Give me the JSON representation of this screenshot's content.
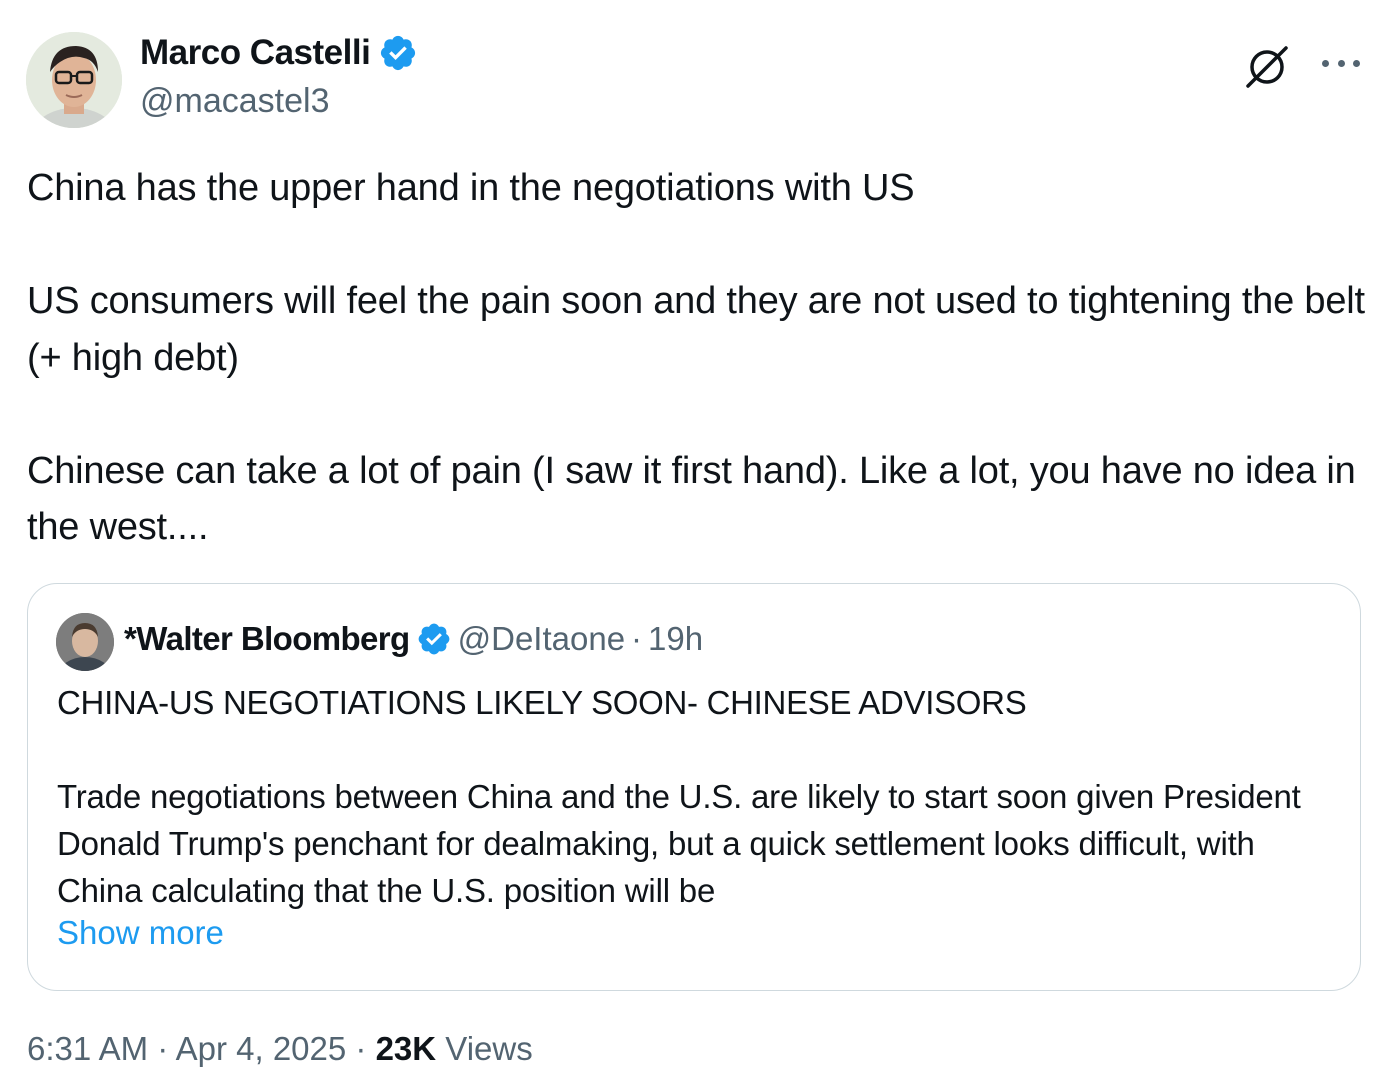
{
  "author": {
    "display_name": "Marco Castelli",
    "handle": "@macastel3"
  },
  "tweet": {
    "paragraphs": [
      "China has the upper hand in the negotiations with US",
      "US consumers will feel the pain soon and they are not used to tightening the belt (+ high debt)",
      "Chinese can take a lot of pain (I saw it first hand). Like a lot, you have no idea in the west...."
    ]
  },
  "quote": {
    "display_name": "*Walter Bloomberg",
    "handle": "@DeItaone",
    "separator": "·",
    "time": "19h",
    "headline": "CHINA-US NEGOTIATIONS LIKELY SOON- CHINESE ADVISORS",
    "body": "Trade negotiations between China and the U.S. are likely to start soon given President Donald Trump's penchant for dealmaking, but a quick settlement looks difficult, with China calculating that the U.S. position will be",
    "show_more": "Show more"
  },
  "meta": {
    "time": "6:31 AM",
    "separator": "·",
    "date": "Apr 4, 2025",
    "views_count": "23K",
    "views_label": "Views"
  },
  "icons": {
    "verified": "verified-badge-icon",
    "grok": "grok-icon",
    "more": "more-options-icon"
  },
  "colors": {
    "verified_blue": "#1d9bf0",
    "link_blue": "#1d9bf0",
    "secondary_text": "#536471",
    "primary_text": "#0f1419",
    "card_border": "#cfd9de"
  }
}
